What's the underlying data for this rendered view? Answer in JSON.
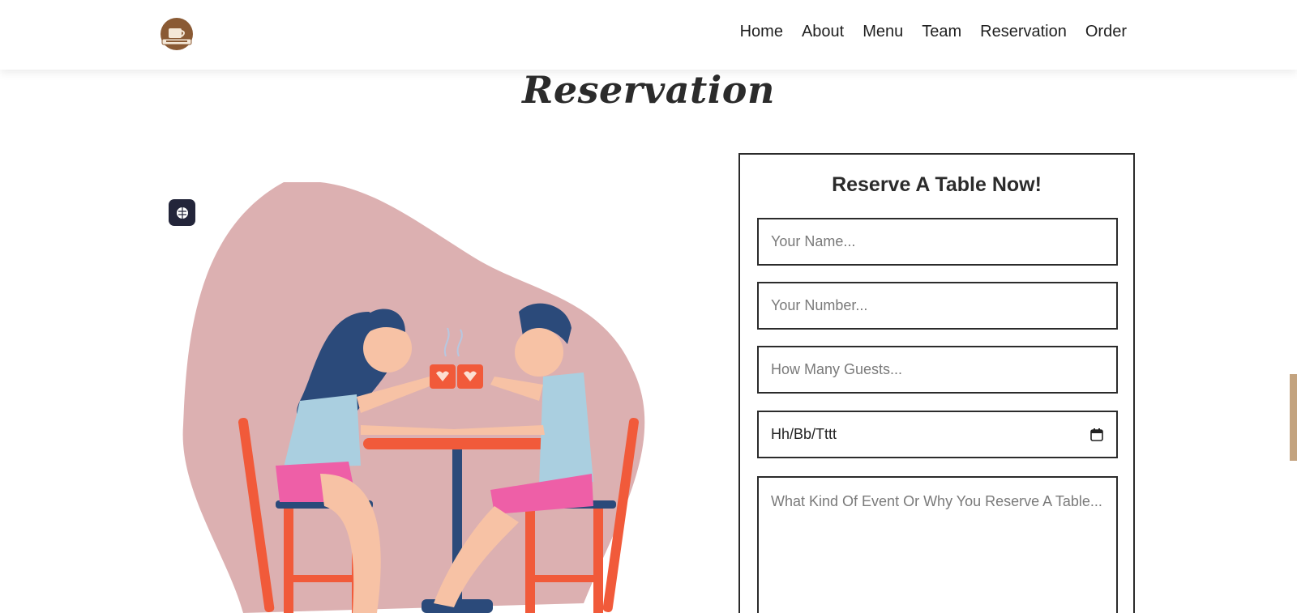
{
  "nav": {
    "logo_icon": "coffee-cup-logo",
    "links": [
      "Home",
      "About",
      "Menu",
      "Team",
      "Reservation",
      "Order"
    ]
  },
  "section": {
    "title": "Reservation"
  },
  "illustration": {
    "badge_icon": "brain-icon"
  },
  "form": {
    "heading": "Reserve A Table Now!",
    "name_placeholder": "Your Name...",
    "number_placeholder": "Your Number...",
    "guests_placeholder": "How Many Guests...",
    "date_value": "Hh/Bb/Tttt",
    "date_icon": "calendar-icon",
    "event_placeholder": "What Kind Of Event Or Why You Reserve A Table..."
  },
  "colors": {
    "blob": "#dcb0b1",
    "accent_orange": "#f15a3a",
    "navy": "#2b4a7a",
    "pink": "#ee5fa7",
    "light_blue": "#aacfe0",
    "skin": "#f7c2a5",
    "scroll_tab": "#c3a37f"
  }
}
